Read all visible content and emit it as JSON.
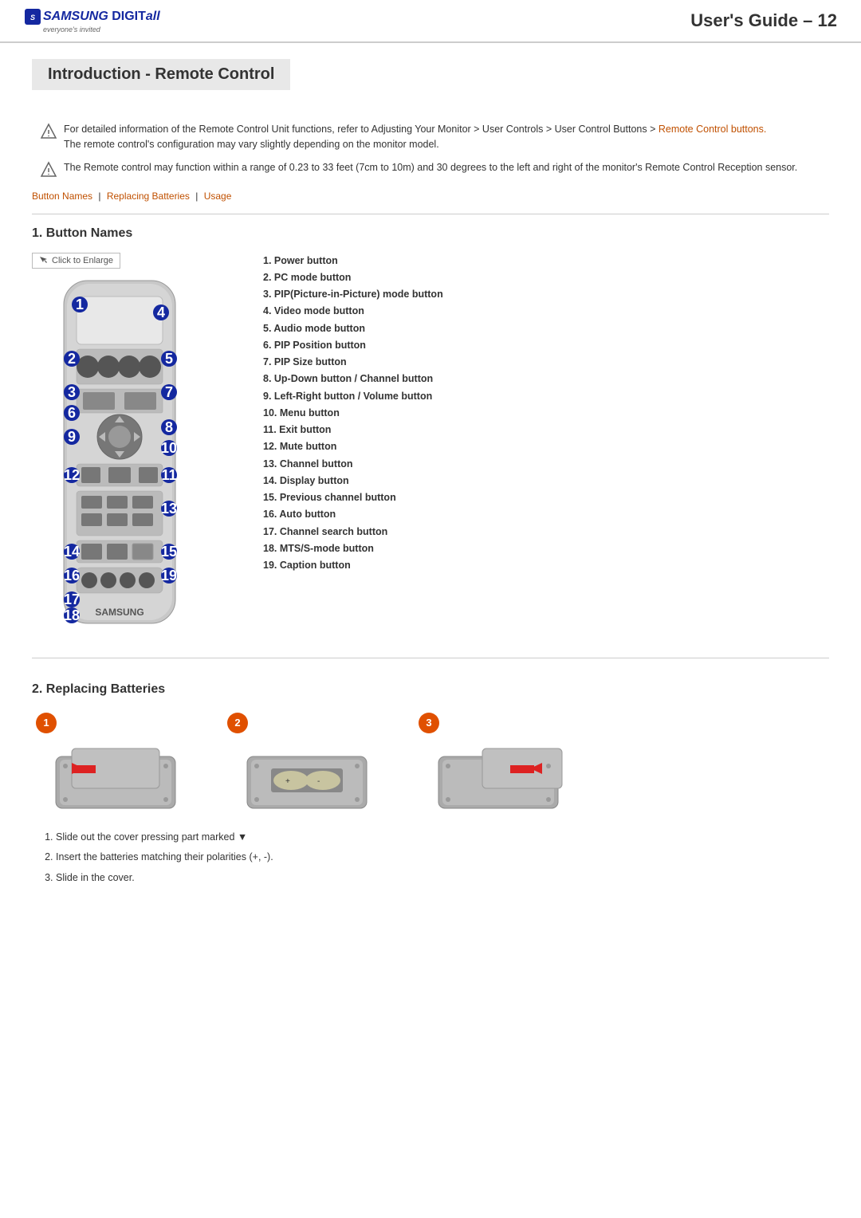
{
  "header": {
    "logo_brand": "SAMSUNG",
    "logo_digit": "DIGITall",
    "logo_tagline": "everyone's invited",
    "page_number": "User's Guide – 12"
  },
  "page_title": "Introduction - Remote Control",
  "notes": [
    {
      "text": "For detailed information of the Remote Control Unit functions, refer to Adjusting Your Monitor > User Controls > User Control Buttons > Remote Control buttons.\nThe remote control's configuration may vary slightly depending on the monitor model."
    },
    {
      "text": "The Remote control may function within a range of 0.23 to 33 feet (7cm to 10m) and 30 degrees to the left and right of the monitor's Remote Control Reception sensor."
    }
  ],
  "nav_links": [
    "Button Names",
    "Replacing Batteries",
    "Usage"
  ],
  "section1": {
    "title": "1. Button Names",
    "enlarge_label": "Click to Enlarge",
    "buttons": [
      "1.  Power button",
      "2.  PC mode button",
      "3.  PIP(Picture-in-Picture) mode button",
      "4.  Video mode button",
      "5.  Audio mode button",
      "6.  PIP Position button",
      "7.  PIP Size button",
      "8.  Up-Down button / Channel button",
      "9.  Left-Right button / Volume button",
      "10. Menu button",
      "11. Exit button",
      "12. Mute button",
      "13. Channel button",
      "14. Display button",
      "15. Previous channel button",
      "16. Auto button",
      "17. Channel search button",
      "18. MTS/S-mode button",
      "19. Caption button"
    ]
  },
  "section2": {
    "title": "2. Replacing Batteries",
    "steps": [
      "Slide out the cover pressing part marked ▼",
      "Insert the batteries matching their polarities (+, -).",
      "Slide in the cover."
    ]
  },
  "colors": {
    "link": "#c05000",
    "accent": "#1428A0",
    "step_circle": "#e05000"
  }
}
